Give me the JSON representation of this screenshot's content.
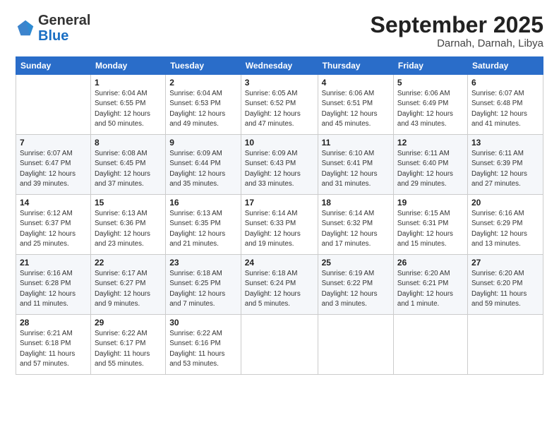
{
  "header": {
    "logo": {
      "general": "General",
      "blue": "Blue"
    },
    "title": "September 2025",
    "location": "Darnah, Darnah, Libya"
  },
  "weekdays": [
    "Sunday",
    "Monday",
    "Tuesday",
    "Wednesday",
    "Thursday",
    "Friday",
    "Saturday"
  ],
  "weeks": [
    [
      {
        "day": "",
        "sunrise": "",
        "sunset": "",
        "daylight": ""
      },
      {
        "day": "1",
        "sunrise": "Sunrise: 6:04 AM",
        "sunset": "Sunset: 6:55 PM",
        "daylight": "Daylight: 12 hours and 50 minutes."
      },
      {
        "day": "2",
        "sunrise": "Sunrise: 6:04 AM",
        "sunset": "Sunset: 6:53 PM",
        "daylight": "Daylight: 12 hours and 49 minutes."
      },
      {
        "day": "3",
        "sunrise": "Sunrise: 6:05 AM",
        "sunset": "Sunset: 6:52 PM",
        "daylight": "Daylight: 12 hours and 47 minutes."
      },
      {
        "day": "4",
        "sunrise": "Sunrise: 6:06 AM",
        "sunset": "Sunset: 6:51 PM",
        "daylight": "Daylight: 12 hours and 45 minutes."
      },
      {
        "day": "5",
        "sunrise": "Sunrise: 6:06 AM",
        "sunset": "Sunset: 6:49 PM",
        "daylight": "Daylight: 12 hours and 43 minutes."
      },
      {
        "day": "6",
        "sunrise": "Sunrise: 6:07 AM",
        "sunset": "Sunset: 6:48 PM",
        "daylight": "Daylight: 12 hours and 41 minutes."
      }
    ],
    [
      {
        "day": "7",
        "sunrise": "Sunrise: 6:07 AM",
        "sunset": "Sunset: 6:47 PM",
        "daylight": "Daylight: 12 hours and 39 minutes."
      },
      {
        "day": "8",
        "sunrise": "Sunrise: 6:08 AM",
        "sunset": "Sunset: 6:45 PM",
        "daylight": "Daylight: 12 hours and 37 minutes."
      },
      {
        "day": "9",
        "sunrise": "Sunrise: 6:09 AM",
        "sunset": "Sunset: 6:44 PM",
        "daylight": "Daylight: 12 hours and 35 minutes."
      },
      {
        "day": "10",
        "sunrise": "Sunrise: 6:09 AM",
        "sunset": "Sunset: 6:43 PM",
        "daylight": "Daylight: 12 hours and 33 minutes."
      },
      {
        "day": "11",
        "sunrise": "Sunrise: 6:10 AM",
        "sunset": "Sunset: 6:41 PM",
        "daylight": "Daylight: 12 hours and 31 minutes."
      },
      {
        "day": "12",
        "sunrise": "Sunrise: 6:11 AM",
        "sunset": "Sunset: 6:40 PM",
        "daylight": "Daylight: 12 hours and 29 minutes."
      },
      {
        "day": "13",
        "sunrise": "Sunrise: 6:11 AM",
        "sunset": "Sunset: 6:39 PM",
        "daylight": "Daylight: 12 hours and 27 minutes."
      }
    ],
    [
      {
        "day": "14",
        "sunrise": "Sunrise: 6:12 AM",
        "sunset": "Sunset: 6:37 PM",
        "daylight": "Daylight: 12 hours and 25 minutes."
      },
      {
        "day": "15",
        "sunrise": "Sunrise: 6:13 AM",
        "sunset": "Sunset: 6:36 PM",
        "daylight": "Daylight: 12 hours and 23 minutes."
      },
      {
        "day": "16",
        "sunrise": "Sunrise: 6:13 AM",
        "sunset": "Sunset: 6:35 PM",
        "daylight": "Daylight: 12 hours and 21 minutes."
      },
      {
        "day": "17",
        "sunrise": "Sunrise: 6:14 AM",
        "sunset": "Sunset: 6:33 PM",
        "daylight": "Daylight: 12 hours and 19 minutes."
      },
      {
        "day": "18",
        "sunrise": "Sunrise: 6:14 AM",
        "sunset": "Sunset: 6:32 PM",
        "daylight": "Daylight: 12 hours and 17 minutes."
      },
      {
        "day": "19",
        "sunrise": "Sunrise: 6:15 AM",
        "sunset": "Sunset: 6:31 PM",
        "daylight": "Daylight: 12 hours and 15 minutes."
      },
      {
        "day": "20",
        "sunrise": "Sunrise: 6:16 AM",
        "sunset": "Sunset: 6:29 PM",
        "daylight": "Daylight: 12 hours and 13 minutes."
      }
    ],
    [
      {
        "day": "21",
        "sunrise": "Sunrise: 6:16 AM",
        "sunset": "Sunset: 6:28 PM",
        "daylight": "Daylight: 12 hours and 11 minutes."
      },
      {
        "day": "22",
        "sunrise": "Sunrise: 6:17 AM",
        "sunset": "Sunset: 6:27 PM",
        "daylight": "Daylight: 12 hours and 9 minutes."
      },
      {
        "day": "23",
        "sunrise": "Sunrise: 6:18 AM",
        "sunset": "Sunset: 6:25 PM",
        "daylight": "Daylight: 12 hours and 7 minutes."
      },
      {
        "day": "24",
        "sunrise": "Sunrise: 6:18 AM",
        "sunset": "Sunset: 6:24 PM",
        "daylight": "Daylight: 12 hours and 5 minutes."
      },
      {
        "day": "25",
        "sunrise": "Sunrise: 6:19 AM",
        "sunset": "Sunset: 6:22 PM",
        "daylight": "Daylight: 12 hours and 3 minutes."
      },
      {
        "day": "26",
        "sunrise": "Sunrise: 6:20 AM",
        "sunset": "Sunset: 6:21 PM",
        "daylight": "Daylight: 12 hours and 1 minute."
      },
      {
        "day": "27",
        "sunrise": "Sunrise: 6:20 AM",
        "sunset": "Sunset: 6:20 PM",
        "daylight": "Daylight: 11 hours and 59 minutes."
      }
    ],
    [
      {
        "day": "28",
        "sunrise": "Sunrise: 6:21 AM",
        "sunset": "Sunset: 6:18 PM",
        "daylight": "Daylight: 11 hours and 57 minutes."
      },
      {
        "day": "29",
        "sunrise": "Sunrise: 6:22 AM",
        "sunset": "Sunset: 6:17 PM",
        "daylight": "Daylight: 11 hours and 55 minutes."
      },
      {
        "day": "30",
        "sunrise": "Sunrise: 6:22 AM",
        "sunset": "Sunset: 6:16 PM",
        "daylight": "Daylight: 11 hours and 53 minutes."
      },
      {
        "day": "",
        "sunrise": "",
        "sunset": "",
        "daylight": ""
      },
      {
        "day": "",
        "sunrise": "",
        "sunset": "",
        "daylight": ""
      },
      {
        "day": "",
        "sunrise": "",
        "sunset": "",
        "daylight": ""
      },
      {
        "day": "",
        "sunrise": "",
        "sunset": "",
        "daylight": ""
      }
    ]
  ]
}
